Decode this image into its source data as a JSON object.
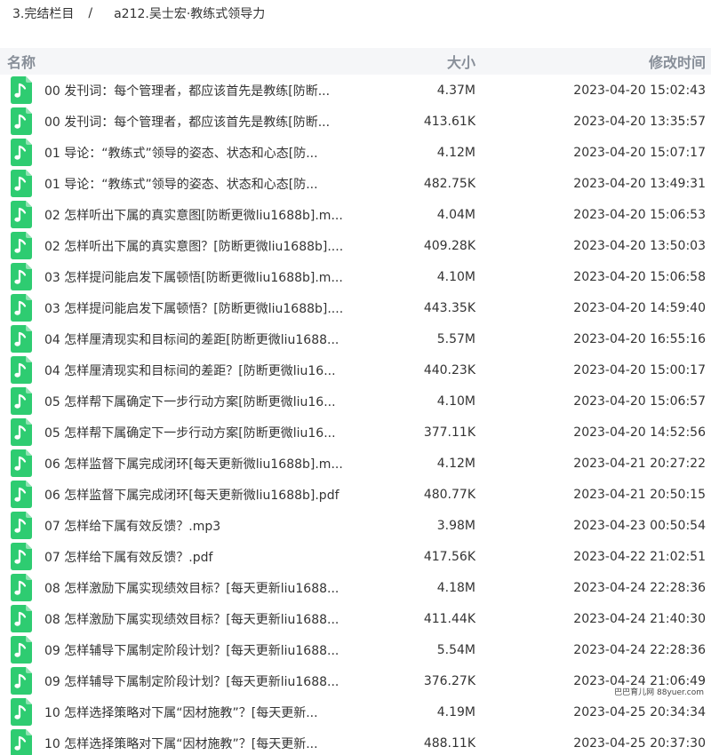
{
  "breadcrumb": {
    "parent": "3.完结栏目",
    "separator": "/",
    "current": "a212.吴士宏·教练式领导力"
  },
  "columns": {
    "name": "名称",
    "size": "大小",
    "modified": "修改时间"
  },
  "icon": "music-file-icon",
  "colors": {
    "icon_green": "#2ecc71",
    "header_bg": "#f5f6f8",
    "header_text": "#888f99"
  },
  "files": [
    {
      "name": "00 发刊词：每个管理者，都应该首先是教练[防断...",
      "size": "4.37M",
      "modified": "2023-04-20 15:02:43"
    },
    {
      "name": "00 发刊词：每个管理者，都应该首先是教练[防断...",
      "size": "413.61K",
      "modified": "2023-04-20 13:35:57"
    },
    {
      "name": "01 导论：“教练式”领导的姿态、状态和心态[防...",
      "size": "4.12M",
      "modified": "2023-04-20 15:07:17"
    },
    {
      "name": "01 导论：“教练式”领导的姿态、状态和心态[防...",
      "size": "482.75K",
      "modified": "2023-04-20 13:49:31"
    },
    {
      "name": "02 怎样听出下属的真实意图[防断更微liu1688b].m...",
      "size": "4.04M",
      "modified": "2023-04-20 15:06:53"
    },
    {
      "name": "02 怎样听出下属的真实意图？[防断更微liu1688b]....",
      "size": "409.28K",
      "modified": "2023-04-20 13:50:03"
    },
    {
      "name": "03 怎样提问能启发下属顿悟[防断更微liu1688b].m...",
      "size": "4.10M",
      "modified": "2023-04-20 15:06:58"
    },
    {
      "name": "03 怎样提问能启发下属顿悟？[防断更微liu1688b]....",
      "size": "443.35K",
      "modified": "2023-04-20 14:59:40"
    },
    {
      "name": "04 怎样厘清现实和目标间的差距[防断更微liu1688...",
      "size": "5.57M",
      "modified": "2023-04-20 16:55:16"
    },
    {
      "name": "04 怎样厘清现实和目标间的差距？[防断更微liu16...",
      "size": "440.23K",
      "modified": "2023-04-20 15:00:17"
    },
    {
      "name": "05 怎样帮下属确定下一步行动方案[防断更微liu16...",
      "size": "4.10M",
      "modified": "2023-04-20 15:06:57"
    },
    {
      "name": "05 怎样帮下属确定下一步行动方案[防断更微liu16...",
      "size": "377.11K",
      "modified": "2023-04-20 14:52:56"
    },
    {
      "name": "06 怎样监督下属完成闭环[每天更新微liu1688b].m...",
      "size": "4.12M",
      "modified": "2023-04-21 20:27:22"
    },
    {
      "name": "06 怎样监督下属完成闭环[每天更新微liu1688b].pdf",
      "size": "480.77K",
      "modified": "2023-04-21 20:50:15"
    },
    {
      "name": "07 怎样给下属有效反馈？.mp3",
      "size": "3.98M",
      "modified": "2023-04-23 00:50:54"
    },
    {
      "name": "07 怎样给下属有效反馈？.pdf",
      "size": "417.56K",
      "modified": "2023-04-22 21:02:51"
    },
    {
      "name": "08 怎样激励下属实现绩效目标？[每天更新liu1688...",
      "size": "4.18M",
      "modified": "2023-04-24 22:28:36"
    },
    {
      "name": "08 怎样激励下属实现绩效目标？[每天更新liu1688...",
      "size": "411.44K",
      "modified": "2023-04-24 21:40:30"
    },
    {
      "name": "09 怎样辅导下属制定阶段计划？[每天更新liu1688...",
      "size": "5.54M",
      "modified": "2023-04-24 22:28:36"
    },
    {
      "name": "09 怎样辅导下属制定阶段计划？[每天更新liu1688...",
      "size": "376.27K",
      "modified": "2023-04-24 21:06:49"
    },
    {
      "name": "10 怎样选择策略对下属“因材施教”？[每天更新...",
      "size": "4.19M",
      "modified": "2023-04-25 20:34:34"
    },
    {
      "name": "10 怎样选择策略对下属“因材施教”？[每天更新...",
      "size": "488.11K",
      "modified": "2023-04-25 20:37:30"
    }
  ],
  "watermark": "巴巴育儿网 88yuer.com"
}
